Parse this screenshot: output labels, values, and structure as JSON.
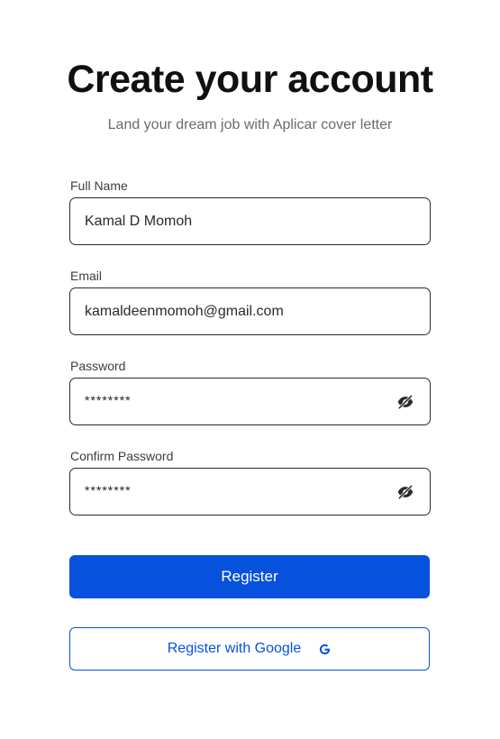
{
  "header": {
    "title": "Create your account",
    "subtitle": "Land your dream job with Aplicar cover letter"
  },
  "form": {
    "full_name": {
      "label": "Full Name",
      "value": "Kamal D Momoh"
    },
    "email": {
      "label": "Email",
      "value": "kamaldeenmomoh@gmail.com"
    },
    "password": {
      "label": "Password",
      "value": "********",
      "toggle_icon": "eye-off-icon"
    },
    "confirm_password": {
      "label": "Confirm Password",
      "value": "********",
      "toggle_icon": "eye-off-icon"
    }
  },
  "actions": {
    "register_label": "Register",
    "register_google_label": "Register with Google",
    "google_icon": "google-icon"
  },
  "colors": {
    "primary": "#0652dd",
    "border": "#2a2a2a",
    "subtitle": "#6b6b6b"
  }
}
